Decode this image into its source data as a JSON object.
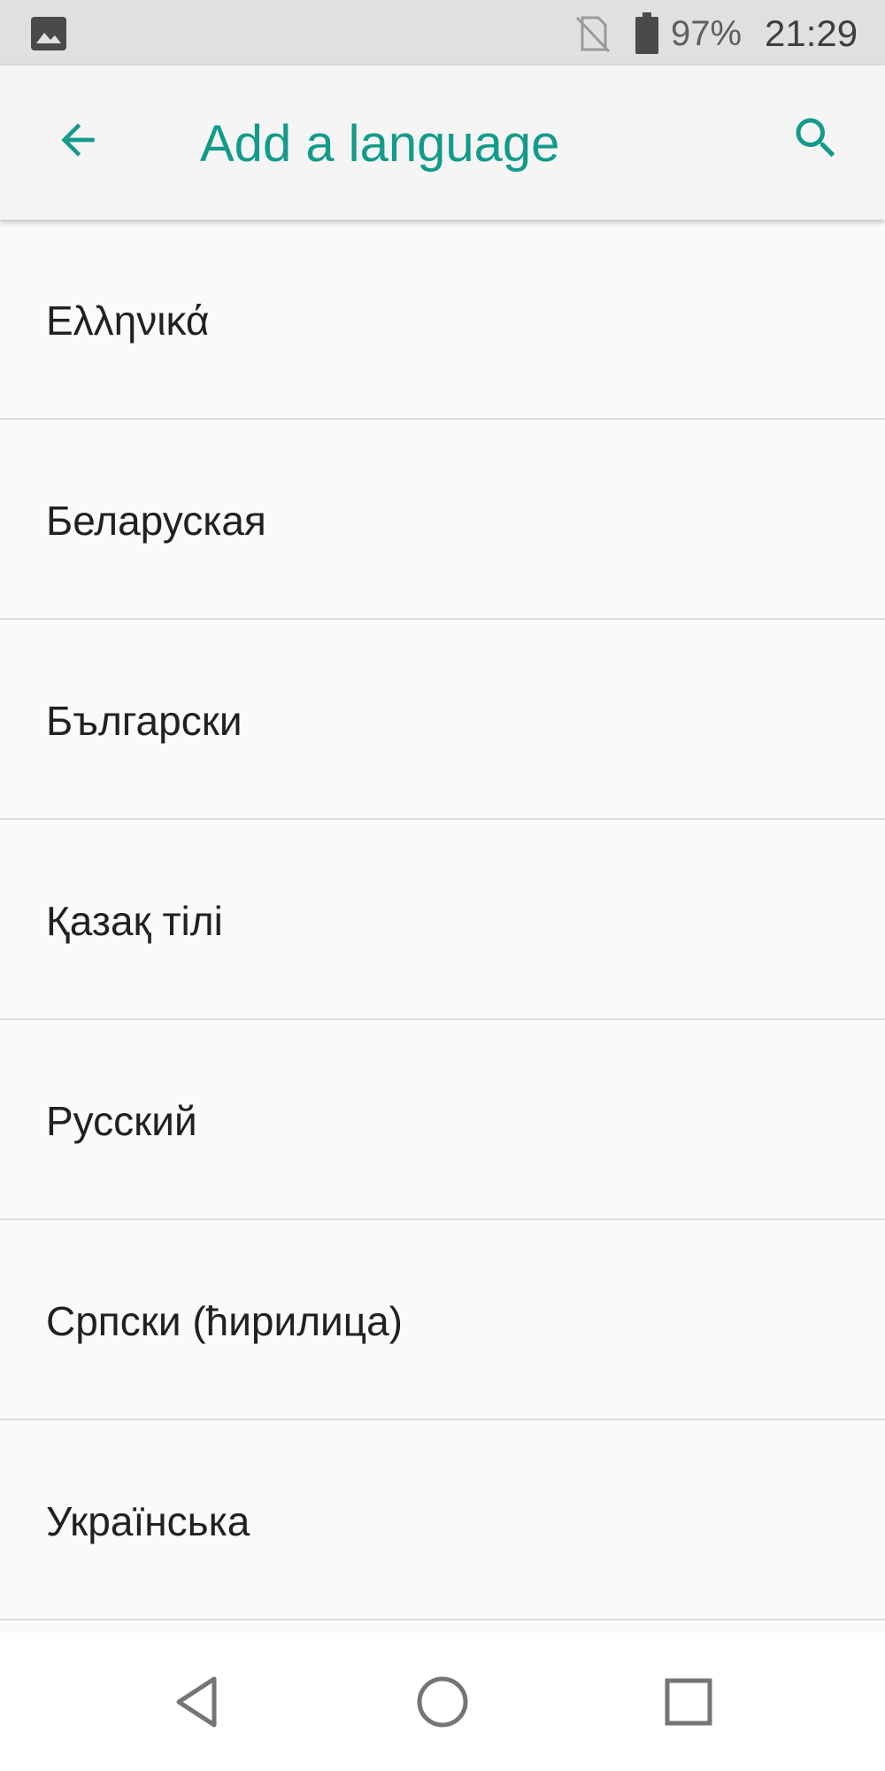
{
  "status_bar": {
    "battery_percent": "97%",
    "time": "21:29",
    "icons": [
      "gallery-icon",
      "no-sim-icon",
      "battery-icon"
    ]
  },
  "app_bar": {
    "title": "Add a language",
    "accent_color": "#139b8a",
    "icons": [
      "back-arrow-icon",
      "search-icon"
    ]
  },
  "languages": [
    {
      "label": "Ελληνικά"
    },
    {
      "label": "Беларуская"
    },
    {
      "label": "Български"
    },
    {
      "label": "Қазақ тілі"
    },
    {
      "label": "Русский"
    },
    {
      "label": "Српски (ћирилица)"
    },
    {
      "label": "Українська"
    }
  ],
  "nav_bar": {
    "icons": [
      "nav-back-icon",
      "nav-home-icon",
      "nav-recents-icon"
    ]
  }
}
